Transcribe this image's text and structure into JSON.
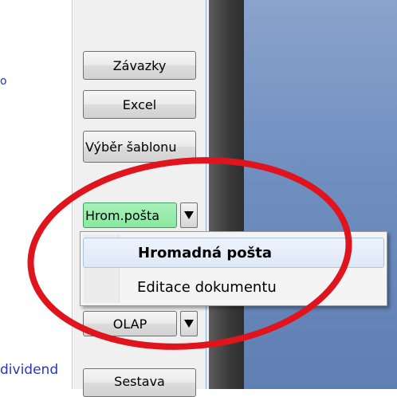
{
  "left_panel": {
    "links": [
      {
        "text": "o"
      },
      {
        "text": "dividend"
      }
    ]
  },
  "buttons": {
    "zavazky": "Závazky",
    "excel": "Excel",
    "vyber_sablonu": "Výběr šablonu",
    "hrom_posta": "Hrom.pošta",
    "olap": "OLAP",
    "sestava": "Sestava"
  },
  "menu": {
    "items": [
      {
        "label": "Hromadná pošta",
        "highlighted": true,
        "bold": true
      },
      {
        "label": "Editace dokumentu",
        "highlighted": false,
        "bold": false
      }
    ]
  },
  "colors": {
    "accent_green": "#8ae8a0",
    "annotation_red": "#e0141c",
    "desktop_blue": "#6f8fc0"
  }
}
